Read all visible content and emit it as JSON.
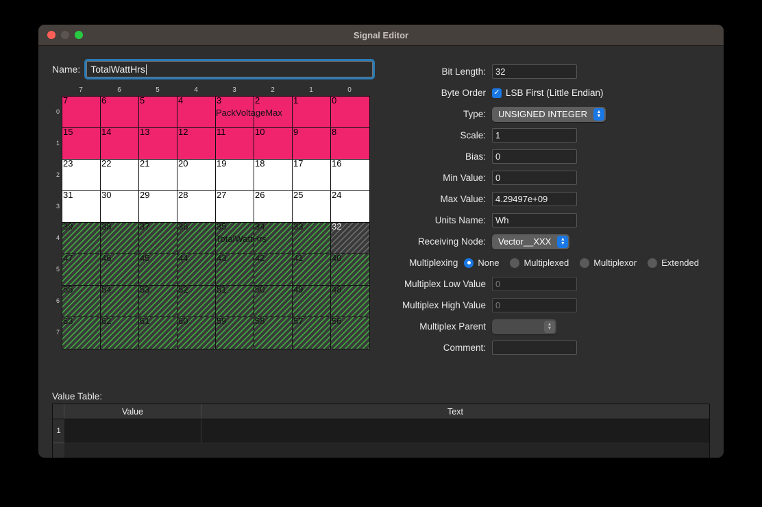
{
  "window": {
    "title": "Signal Editor",
    "traffic_lights": [
      "close-button",
      "minimize-button",
      "zoom-button"
    ]
  },
  "name_field": {
    "label": "Name:",
    "value": "TotalWattHrs"
  },
  "bit_grid": {
    "column_headers": [
      "7",
      "6",
      "5",
      "4",
      "3",
      "2",
      "1",
      "0"
    ],
    "row_headers": [
      "0",
      "1",
      "2",
      "3",
      "4",
      "5",
      "6",
      "7"
    ],
    "colors": {
      "pink": "#f0246d",
      "white": "#ffffff",
      "hatch_green": "#3fa63f",
      "hatch_selected": "#6a6a6a",
      "hatch_bg": "#3a3a3a"
    },
    "labels": [
      {
        "row": 0,
        "col": 4,
        "text": "PackVoltageMax"
      },
      {
        "row": 4,
        "col": 4,
        "text": "TotalWattHrs"
      }
    ],
    "rows": [
      {
        "index": "0",
        "style": "pink",
        "cells": [
          "7",
          "6",
          "5",
          "4",
          "3",
          "2",
          "1",
          "0"
        ]
      },
      {
        "index": "1",
        "style": "pink",
        "cells": [
          "15",
          "14",
          "13",
          "12",
          "11",
          "10",
          "9",
          "8"
        ]
      },
      {
        "index": "2",
        "style": "white",
        "cells": [
          "23",
          "22",
          "21",
          "20",
          "19",
          "18",
          "17",
          "16"
        ]
      },
      {
        "index": "3",
        "style": "white",
        "cells": [
          "31",
          "30",
          "29",
          "28",
          "27",
          "26",
          "25",
          "24"
        ]
      },
      {
        "index": "4",
        "style": "hatch",
        "cells": [
          "39",
          "38",
          "37",
          "36",
          "35",
          "34",
          "33",
          "32"
        ],
        "selected_cells": [
          "32"
        ]
      },
      {
        "index": "5",
        "style": "hatch",
        "cells": [
          "47",
          "46",
          "45",
          "44",
          "43",
          "42",
          "41",
          "40"
        ]
      },
      {
        "index": "6",
        "style": "hatch",
        "cells": [
          "55",
          "54",
          "53",
          "52",
          "51",
          "50",
          "49",
          "48"
        ]
      },
      {
        "index": "7",
        "style": "hatch",
        "cells": [
          "63",
          "62",
          "61",
          "60",
          "59",
          "58",
          "57",
          "56"
        ]
      }
    ]
  },
  "form": {
    "bit_length": {
      "label": "Bit Length:",
      "value": "32"
    },
    "byte_order": {
      "label": "Byte Order",
      "checkbox_label": "LSB First (Little Endian)",
      "checked": true,
      "check_glyph": "✓"
    },
    "type": {
      "label": "Type:",
      "value": "UNSIGNED INTEGER"
    },
    "scale": {
      "label": "Scale:",
      "value": "1"
    },
    "bias": {
      "label": "Bias:",
      "value": "0"
    },
    "min_value": {
      "label": "Min Value:",
      "value": "0"
    },
    "max_value": {
      "label": "Max Value:",
      "value": "4.29497e+09"
    },
    "units_name": {
      "label": "Units Name:",
      "value": "Wh"
    },
    "receiving_node": {
      "label": "Receiving Node:",
      "value": "Vector__XXX"
    },
    "multiplexing": {
      "label": "Multiplexing",
      "options": [
        "None",
        "Multiplexed",
        "Multiplexor",
        "Extended"
      ],
      "selected": "None"
    },
    "multiplex_low": {
      "label": "Multiplex Low Value",
      "placeholder": "0",
      "disabled": true
    },
    "multiplex_high": {
      "label": "Multiplex High Value",
      "placeholder": "0",
      "disabled": true
    },
    "multiplex_parent": {
      "label": "Multiplex Parent",
      "value": "",
      "disabled": true
    },
    "comment": {
      "label": "Comment:",
      "value": ""
    }
  },
  "value_table": {
    "label": "Value Table:",
    "columns": [
      "Value",
      "Text"
    ],
    "rows": [
      {
        "number": "1",
        "value": "",
        "text": ""
      }
    ]
  },
  "icons": {
    "stepper_up": "▲",
    "stepper_down": "▼"
  }
}
